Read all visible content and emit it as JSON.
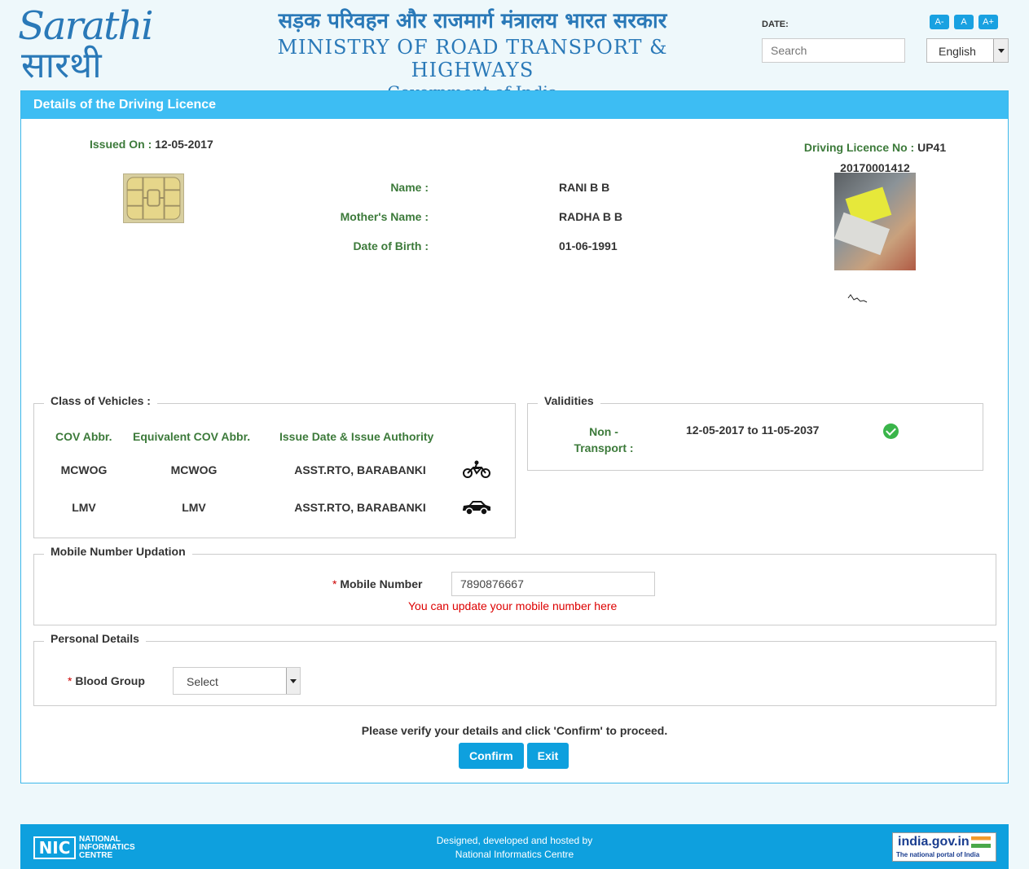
{
  "header": {
    "logo_en": "Sarathi",
    "logo_hi": "सारथी",
    "ministry_hi": "सड़क परिवहन और राजमार्ग मंत्रालय भारत सरकार",
    "ministry_en": "MINISTRY OF ROAD TRANSPORT & HIGHWAYS",
    "ministry_gov": "Government of India",
    "date_label": "DATE:",
    "font_controls": [
      "A-",
      "A",
      "A+"
    ],
    "search_placeholder": "Search",
    "language": "English"
  },
  "panel": {
    "title": "Details of the Driving Licence",
    "issued_on_label": "Issued On :",
    "issued_on": "12-05-2017",
    "dl_no_label": "Driving Licence No :",
    "dl_no_prefix": "UP41",
    "dl_no_rest": "20170001412",
    "name_label": "Name :",
    "name": "RANI B B",
    "mother_label": "Mother's Name :",
    "mother": "RADHA B B",
    "dob_label": "Date of Birth :",
    "dob": "01-06-1991"
  },
  "vehicles": {
    "legend": "Class of Vehicles :",
    "headers": [
      "COV Abbr.",
      "Equivalent COV Abbr.",
      "Issue Date & Issue Authority"
    ],
    "rows": [
      {
        "cov": "MCWOG",
        "equiv": "MCWOG",
        "authority": "ASST.RTO, BARABANKI",
        "icon": "motorcycle-icon"
      },
      {
        "cov": "LMV",
        "equiv": "LMV",
        "authority": "ASST.RTO, BARABANKI",
        "icon": "car-icon"
      }
    ]
  },
  "validities": {
    "legend": "Validities",
    "type_line1": "Non -",
    "type_line2": "Transport :",
    "range": "12-05-2017 to 11-05-2037",
    "status_icon": "check-circle-icon"
  },
  "mobile": {
    "legend": "Mobile Number Updation",
    "required": "*",
    "label": "Mobile Number",
    "value": "7890876667",
    "hint": "You can update your mobile number here"
  },
  "personal": {
    "legend": "Personal Details",
    "required": "*",
    "blood_label": "Blood Group",
    "blood_value": "Select"
  },
  "actions": {
    "verify_text": "Please verify your details and click 'Confirm' to proceed.",
    "confirm": "Confirm",
    "exit": "Exit"
  },
  "footer": {
    "nic_logo": "NIC",
    "nic_line1": "NATIONAL",
    "nic_line2": "INFORMATICS",
    "nic_line3": "CENTRE",
    "credit_line1": "Designed, developed and hosted by",
    "credit_line2": "National Informatics Centre",
    "india_gov": "india.gov.in",
    "india_gov_tag": "The national portal of India"
  },
  "colors": {
    "accent": "#3dbdf3",
    "button": "#0ea0de",
    "label_green": "#3c7a3a",
    "error_red": "#d00"
  }
}
